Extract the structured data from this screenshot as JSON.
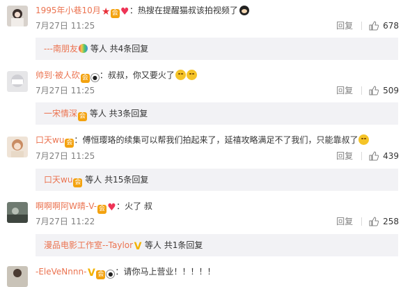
{
  "comments": [
    {
      "username": "1995年小巷10月",
      "badges": [
        "star-icon",
        "vip-icon",
        "heart-icon"
      ],
      "separator": "：",
      "text": "热搜在提醒猫叔该拍视频了",
      "trailing_emoji": "mickey-icon",
      "time": "7月27日 11:25",
      "reply_label": "回复",
      "likes": "678",
      "sub_reply": {
        "name": "---南朋友",
        "badges": [
          "rainbow-heart-icon"
        ],
        "suffix": "等人 共4条回复"
      }
    },
    {
      "username": "帅到·被人砍",
      "badges": [
        "vip-icon",
        "panda-icon"
      ],
      "separator": "：",
      "text": "叔叔，你又要火了",
      "trailing_emoji": "pray-emoji",
      "time": "7月27日 11:25",
      "reply_label": "回复",
      "likes": "509",
      "sub_reply": {
        "name": "一宋情深",
        "badges": [
          "vip-icon"
        ],
        "suffix": "等人 共3条回复"
      }
    },
    {
      "username": "口天wu",
      "badges": [
        "vip-icon"
      ],
      "separator": "：",
      "text": "傅恒璎珞的续集可以帮我们拍起来了，延禧攻略满足不了我们，只能靠叔了",
      "trailing_emoji": "smirk-emoji",
      "time": "7月27日 11:25",
      "reply_label": "回复",
      "likes": "439",
      "sub_reply": {
        "name": "口天wu",
        "badges": [
          "vip-icon"
        ],
        "suffix": "等人 共15条回复"
      }
    },
    {
      "username": "啊啊啊阿W晴-V-",
      "badges": [
        "vip-icon",
        "heart-icon"
      ],
      "separator": "：",
      "text": "火了 叔",
      "time": "7月27日 11:22",
      "reply_label": "回复",
      "likes": "258",
      "sub_reply": {
        "name": "漫品电影工作室--Taylor",
        "badges": [
          "v-icon"
        ],
        "suffix": "等人 共1条回复"
      }
    },
    {
      "username": "-EleVeNnnn-",
      "badges": [
        "v-icon",
        "vip-icon",
        "panda-icon"
      ],
      "separator": "：",
      "text": "请你马上营业！！！！！"
    }
  ],
  "colors": {
    "username": "#eb7350",
    "text": "#333333",
    "meta": "#808080",
    "sub_box_bg": "#f2f2f5"
  }
}
